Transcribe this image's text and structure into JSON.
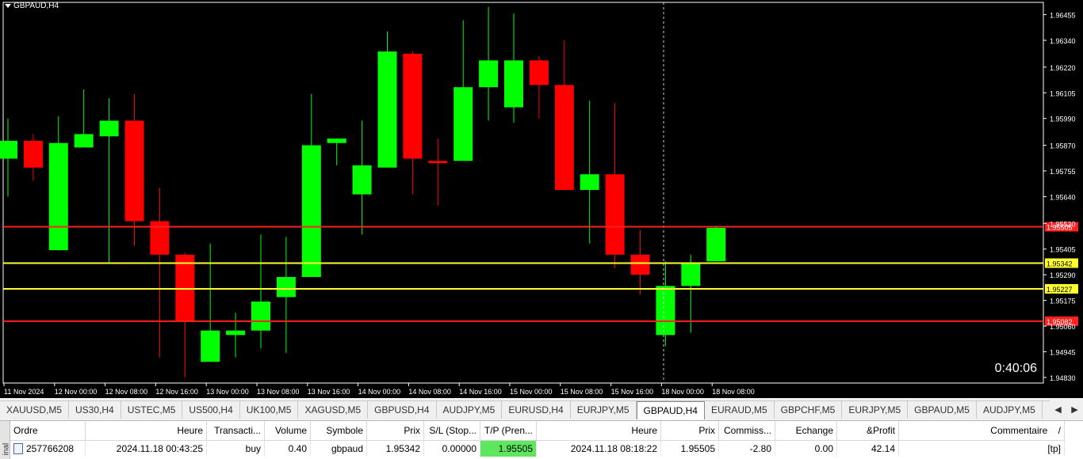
{
  "chart": {
    "symbol": "GBPAUD,H4",
    "countdown": "0:40:06",
    "price_axis": {
      "ticks": [
        "1.96455",
        "1.96340",
        "1.96220",
        "1.96105",
        "1.95990",
        "1.95870",
        "1.95755",
        "1.95640",
        "1.95520",
        "1.95405",
        "1.95290",
        "1.95175",
        "1.95060",
        "1.94945",
        "1.94830"
      ]
    },
    "time_axis": [
      "11 Nov 2024",
      "12 Nov 00:00",
      "12 Nov 08:00",
      "12 Nov 16:00",
      "13 Nov 00:00",
      "13 Nov 08:00",
      "13 Nov 16:00",
      "14 Nov 00:00",
      "14 Nov 08:00",
      "14 Nov 16:00",
      "15 Nov 00:00",
      "15 Nov 08:00",
      "15 Nov 16:00",
      "18 Nov 00:00",
      "18 Nov 08:00"
    ],
    "levels": [
      {
        "price": 1.95505,
        "label": "1.95505",
        "color": "#ff2020",
        "label_bg": "#ff2020",
        "label_color": "#ffffff"
      },
      {
        "price": 1.95342,
        "label": "1.95342",
        "color": "#ffff30",
        "label_bg": "#ffff30",
        "label_color": "#000000"
      },
      {
        "price": 1.95227,
        "label": "1.95227",
        "color": "#ffff30",
        "label_bg": "#ffff30",
        "label_color": "#000000"
      },
      {
        "price": 1.95082,
        "label": "1.95082",
        "color": "#ff2020",
        "label_bg": "#ff2020",
        "label_color": "#ffffff"
      }
    ],
    "up_color": "#00ff00",
    "down_color": "#ff0000",
    "candles": [
      {
        "o": 1.9581,
        "h": 1.9599,
        "l": 1.9564,
        "c": 1.9589
      },
      {
        "o": 1.9589,
        "h": 1.9592,
        "l": 1.9571,
        "c": 1.9577
      },
      {
        "o": 1.954,
        "h": 1.96,
        "l": 1.954,
        "c": 1.9588
      },
      {
        "o": 1.9586,
        "h": 1.9612,
        "l": 1.9586,
        "c": 1.9592
      },
      {
        "o": 1.9591,
        "h": 1.9608,
        "l": 1.9534,
        "c": 1.9598
      },
      {
        "o": 1.9598,
        "h": 1.961,
        "l": 1.9542,
        "c": 1.9553
      },
      {
        "o": 1.9553,
        "h": 1.9568,
        "l": 1.9492,
        "c": 1.9538
      },
      {
        "o": 1.9538,
        "h": 1.9539,
        "l": 1.9483,
        "c": 1.9508
      },
      {
        "o": 1.949,
        "h": 1.9543,
        "l": 1.949,
        "c": 1.9504
      },
      {
        "o": 1.9502,
        "h": 1.9512,
        "l": 1.9492,
        "c": 1.9504
      },
      {
        "o": 1.9504,
        "h": 1.9547,
        "l": 1.9496,
        "c": 1.9517
      },
      {
        "o": 1.9519,
        "h": 1.9546,
        "l": 1.9494,
        "c": 1.9528
      },
      {
        "o": 1.9528,
        "h": 1.961,
        "l": 1.9528,
        "c": 1.9587
      },
      {
        "o": 1.9588,
        "h": 1.959,
        "l": 1.9578,
        "c": 1.959
      },
      {
        "o": 1.9565,
        "h": 1.9598,
        "l": 1.9547,
        "c": 1.9578
      },
      {
        "o": 1.9577,
        "h": 1.9638,
        "l": 1.9577,
        "c": 1.9629
      },
      {
        "o": 1.9628,
        "h": 1.9629,
        "l": 1.9565,
        "c": 1.9581
      },
      {
        "o": 1.958,
        "h": 1.959,
        "l": 1.956,
        "c": 1.9579
      },
      {
        "o": 1.958,
        "h": 1.9643,
        "l": 1.958,
        "c": 1.9613
      },
      {
        "o": 1.9613,
        "h": 1.9649,
        "l": 1.9598,
        "c": 1.9625
      },
      {
        "o": 1.9604,
        "h": 1.9646,
        "l": 1.9597,
        "c": 1.9625
      },
      {
        "o": 1.9625,
        "h": 1.9627,
        "l": 1.9599,
        "c": 1.9614
      },
      {
        "o": 1.9614,
        "h": 1.9634,
        "l": 1.9574,
        "c": 1.9567
      },
      {
        "o": 1.9567,
        "h": 1.9607,
        "l": 1.9543,
        "c": 1.9574
      },
      {
        "o": 1.9574,
        "h": 1.9606,
        "l": 1.9532,
        "c": 1.9538
      },
      {
        "o": 1.9538,
        "h": 1.9549,
        "l": 1.952,
        "c": 1.9529
      },
      {
        "o": 1.9502,
        "h": 1.9535,
        "l": 1.9497,
        "c": 1.9524
      },
      {
        "o": 1.9524,
        "h": 1.9538,
        "l": 1.9503,
        "c": 1.9534
      },
      {
        "o": 1.9535,
        "h": 1.9551,
        "l": 1.9535,
        "c": 1.955
      }
    ]
  },
  "tabs": [
    {
      "label": "XAUUSD,M5",
      "active": false
    },
    {
      "label": "US30,H4",
      "active": false
    },
    {
      "label": "USTEC,M5",
      "active": false
    },
    {
      "label": "US500,H4",
      "active": false
    },
    {
      "label": "UK100,M5",
      "active": false
    },
    {
      "label": "XAGUSD,M5",
      "active": false
    },
    {
      "label": "GBPUSD,H4",
      "active": false
    },
    {
      "label": "AUDJPY,M5",
      "active": false
    },
    {
      "label": "EURUSD,H4",
      "active": false
    },
    {
      "label": "EURJPY,M5",
      "active": false
    },
    {
      "label": "GBPAUD,H4",
      "active": true
    },
    {
      "label": "EURAUD,M5",
      "active": false
    },
    {
      "label": "GBPCHF,M5",
      "active": false
    },
    {
      "label": "EURJPY,M5",
      "active": false
    },
    {
      "label": "GBPAUD,M5",
      "active": false
    },
    {
      "label": "AUDJPY,M5",
      "active": false
    }
  ],
  "tabs_nav": {
    "prev": "◀",
    "next": "▶"
  },
  "terminal": {
    "side_label": "inal",
    "headers": {
      "ordre": "Ordre",
      "heure": "Heure",
      "transaction": "Transacti...",
      "volume": "Volume",
      "symbole": "Symbole",
      "prix": "Prix",
      "sl": "S/L (Stop...",
      "tp": "T/P (Pren...",
      "heure2": "Heure",
      "prix2": "Prix",
      "commission": "Commiss...",
      "echange": "Echange",
      "profit": "&Profit",
      "commentaire": "Commentaire",
      "sort": "/"
    },
    "row": {
      "ordre": "257766208",
      "heure": "2024.11.18 00:43:25",
      "transaction": "buy",
      "volume": "0.40",
      "symbole": "gbpaud",
      "prix": "1.95342",
      "sl": "0.00000",
      "tp": "1.95505",
      "heure2": "2024.11.18 08:18:22",
      "prix2": "1.95505",
      "commission": "-2.80",
      "echange": "0.00",
      "profit": "42.14",
      "commentaire": "[tp]"
    }
  }
}
